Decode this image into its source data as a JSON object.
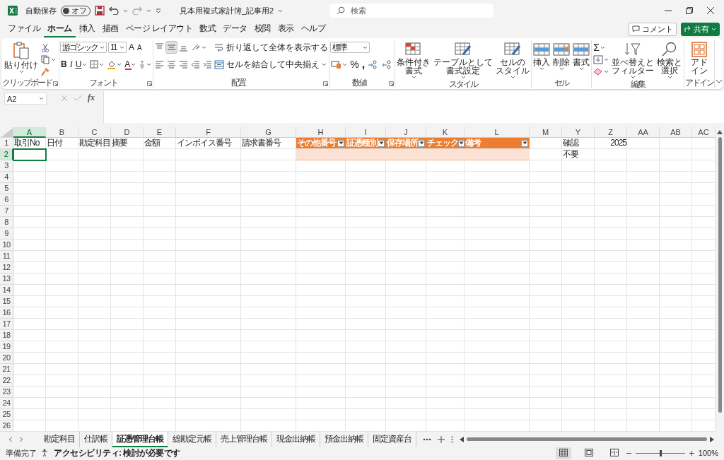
{
  "title_bar": {
    "autosave_label": "自動保存",
    "autosave": {
      "label": "オフ",
      "on": false
    },
    "document_title": "見本用複式家計簿_記事用2",
    "search_placeholder": "検索"
  },
  "menu_tabs": [
    {
      "label": "ファイル",
      "selected": false
    },
    {
      "label": "ホーム",
      "selected": true
    },
    {
      "label": "挿入",
      "selected": false
    },
    {
      "label": "描画",
      "selected": false
    },
    {
      "label": "ページ レイアウト",
      "selected": false
    },
    {
      "label": "数式",
      "selected": false
    },
    {
      "label": "データ",
      "selected": false
    },
    {
      "label": "校閲",
      "selected": false
    },
    {
      "label": "表示",
      "selected": false
    },
    {
      "label": "ヘルプ",
      "selected": false
    }
  ],
  "comment_button": "コメント",
  "share_button": "共有",
  "ribbon": {
    "groups": [
      {
        "label": "クリップボード",
        "launcher": true,
        "blocks": [
          [
            [
              {
                "kind": "paste",
                "label_lines": [
                  "貼り付け"
                ]
              }
            ]
          ],
          [
            [
              {
                "kind": "cut"
              }
            ],
            [
              {
                "kind": "copy"
              }
            ],
            [
              {
                "kind": "format-painter"
              }
            ]
          ]
        ]
      },
      {
        "label": "フォント",
        "launcher": true,
        "blocks": [
          [
            [
              {
                "kind": "font-name",
                "value": "游ゴシック"
              },
              {
                "kind": "font-size",
                "value": "11"
              },
              {
                "kind": "grow-font",
                "text": "A"
              },
              {
                "kind": "shrink-font",
                "text": "A"
              }
            ],
            [
              {
                "kind": "bold",
                "text": "B"
              },
              {
                "kind": "italic",
                "text": "I"
              },
              {
                "kind": "underline",
                "text": "U"
              },
              {
                "kind": "borders"
              },
              {
                "kind": "fill-color"
              },
              {
                "kind": "font-color",
                "text": "A"
              },
              {
                "kind": "phonetic"
              }
            ]
          ]
        ]
      },
      {
        "label": "配置",
        "launcher": true,
        "blocks": [
          [
            [
              {
                "kind": "align-top",
                "selected": false
              },
              {
                "kind": "align-middle",
                "selected": true
              },
              {
                "kind": "align-bottom",
                "selected": false
              },
              {
                "kind": "orientation"
              }
            ],
            [
              {
                "kind": "align-left",
                "selected": false
              },
              {
                "kind": "align-center",
                "selected": false
              },
              {
                "kind": "align-right",
                "selected": false
              },
              {
                "kind": "outdent"
              },
              {
                "kind": "indent"
              }
            ]
          ],
          [
            [
              {
                "kind": "wrap-text",
                "label": "折り返して全体を表示する"
              }
            ],
            [
              {
                "kind": "merge-center",
                "label": "セルを結合して中央揃え"
              }
            ]
          ]
        ]
      },
      {
        "label": "数値",
        "launcher": true,
        "blocks": [
          [
            [
              {
                "kind": "number-format",
                "value": "標準"
              }
            ],
            [
              {
                "kind": "accounting"
              },
              {
                "kind": "percent",
                "text": "%"
              },
              {
                "kind": "comma",
                "text": ","
              },
              {
                "kind": "decimal-increase"
              },
              {
                "kind": "decimal-decrease"
              }
            ]
          ]
        ]
      },
      {
        "label": "スタイル",
        "launcher": false,
        "blocks": [
          [
            [
              {
                "kind": "conditional-format",
                "label_lines": [
                  "条件付き",
                  "書式"
                ]
              }
            ]
          ],
          [
            [
              {
                "kind": "table-format",
                "label_lines": [
                  "テーブルとして",
                  "書式設定"
                ]
              }
            ]
          ],
          [
            [
              {
                "kind": "cell-style",
                "label_lines": [
                  "セルの",
                  "スタイル"
                ]
              }
            ]
          ]
        ]
      },
      {
        "label": "セル",
        "launcher": false,
        "blocks": [
          [
            [
              {
                "kind": "insert",
                "label_lines": [
                  "挿入"
                ]
              }
            ]
          ],
          [
            [
              {
                "kind": "delete",
                "label_lines": [
                  "削除"
                ]
              }
            ]
          ],
          [
            [
              {
                "kind": "format",
                "label_lines": [
                  "書式"
                ]
              }
            ]
          ]
        ]
      },
      {
        "label": "編集",
        "launcher": false,
        "blocks": [
          [
            [
              {
                "kind": "autosum",
                "text": "Σ"
              }
            ],
            [
              {
                "kind": "fill"
              }
            ],
            [
              {
                "kind": "clear"
              }
            ]
          ],
          [
            [
              {
                "kind": "sort-filter",
                "label_lines": [
                  "並べ替えと",
                  "フィルター"
                ]
              }
            ]
          ],
          [
            [
              {
                "kind": "find",
                "label_lines": [
                  "検索と",
                  "選択"
                ]
              }
            ]
          ]
        ]
      },
      {
        "label": "アドイン",
        "launcher": false,
        "blocks": [
          [
            [
              {
                "kind": "add-in",
                "label_lines": [
                  "アド",
                  "イン"
                ]
              }
            ]
          ]
        ]
      }
    ]
  },
  "formula_bar": {
    "name_box": "A2",
    "function_label": "fx"
  },
  "sheet": {
    "columns": [
      {
        "letter": "A",
        "kind": "text",
        "selected": true,
        "cells": [
          "取引No"
        ]
      },
      {
        "letter": "B",
        "kind": "text",
        "selected": false,
        "cells": [
          "日付"
        ]
      },
      {
        "letter": "C",
        "kind": "text",
        "selected": false,
        "cells": [
          "勘定科目"
        ]
      },
      {
        "letter": "D",
        "kind": "text",
        "selected": false,
        "cells": [
          "摘要"
        ]
      },
      {
        "letter": "E",
        "kind": "text",
        "selected": false,
        "cells": [
          "金額"
        ]
      },
      {
        "letter": "F",
        "kind": "text",
        "selected": false,
        "cells": [
          "インボイス番号"
        ]
      },
      {
        "letter": "G",
        "kind": "text",
        "selected": false,
        "cells": [
          "請求書番号"
        ]
      },
      {
        "letter": "H",
        "kind": "table",
        "selected": false,
        "cells": [
          "その他番号"
        ]
      },
      {
        "letter": "I",
        "kind": "table",
        "selected": false,
        "cells": [
          "証憑種別"
        ]
      },
      {
        "letter": "J",
        "kind": "table",
        "selected": false,
        "cells": [
          "保存場所"
        ]
      },
      {
        "letter": "K",
        "kind": "table",
        "selected": false,
        "cells": [
          "チェック"
        ]
      },
      {
        "letter": "L",
        "kind": "table",
        "selected": false,
        "cells": [
          "備考"
        ]
      },
      {
        "letter": "M",
        "kind": "text",
        "selected": false
      },
      {
        "letter": "Y",
        "kind": "text",
        "selected": false,
        "cells": [
          "確認",
          "不要"
        ]
      },
      {
        "letter": "Z",
        "kind": "number",
        "selected": false,
        "cells": [
          "2025"
        ]
      },
      {
        "letter": "AA",
        "kind": "text",
        "selected": false
      },
      {
        "letter": "AB",
        "kind": "text",
        "selected": false
      },
      {
        "letter": "AC",
        "kind": "text",
        "selected": false
      }
    ],
    "rows": [
      {
        "number": "1",
        "selected": false
      },
      {
        "number": "2",
        "selected": true
      },
      {
        "number": "3",
        "selected": false
      },
      {
        "number": "4",
        "selected": false
      },
      {
        "number": "5",
        "selected": false
      },
      {
        "number": "6",
        "selected": false
      },
      {
        "number": "7",
        "selected": false
      },
      {
        "number": "8",
        "selected": false
      },
      {
        "number": "9",
        "selected": false
      },
      {
        "number": "10",
        "selected": false
      },
      {
        "number": "11",
        "selected": false
      },
      {
        "number": "12",
        "selected": false
      },
      {
        "number": "13",
        "selected": false
      },
      {
        "number": "14",
        "selected": false
      },
      {
        "number": "15",
        "selected": false
      },
      {
        "number": "16",
        "selected": false
      },
      {
        "number": "17",
        "selected": false
      },
      {
        "number": "18",
        "selected": false
      },
      {
        "number": "19",
        "selected": false
      },
      {
        "number": "20",
        "selected": false
      },
      {
        "number": "21",
        "selected": false
      },
      {
        "number": "22",
        "selected": false
      },
      {
        "number": "23",
        "selected": false
      },
      {
        "number": "24",
        "selected": false
      },
      {
        "number": "25",
        "selected": false
      },
      {
        "number": "26",
        "selected": false
      }
    ]
  },
  "sheet_tabs": [
    {
      "label": "勘定科目",
      "selected": false
    },
    {
      "label": "仕訳帳",
      "selected": false
    },
    {
      "label": "証憑管理台帳",
      "selected": true
    },
    {
      "label": "総勘定元帳",
      "selected": false
    },
    {
      "label": "売上管理台帳",
      "selected": false
    },
    {
      "label": "現金出納帳",
      "selected": false
    },
    {
      "label": "預金出納帳",
      "selected": false
    },
    {
      "label": "固定資産台",
      "selected": false
    }
  ],
  "status_bar": {
    "ready": "準備完了",
    "accessibility": "アクセシビリティ: 検討が必要です",
    "views": [
      {
        "kind": "normal",
        "selected": true
      },
      {
        "kind": "page-layout",
        "selected": false
      },
      {
        "kind": "page-break",
        "selected": false
      }
    ],
    "zoom": {
      "level": 0.5,
      "label": "100%"
    }
  }
}
